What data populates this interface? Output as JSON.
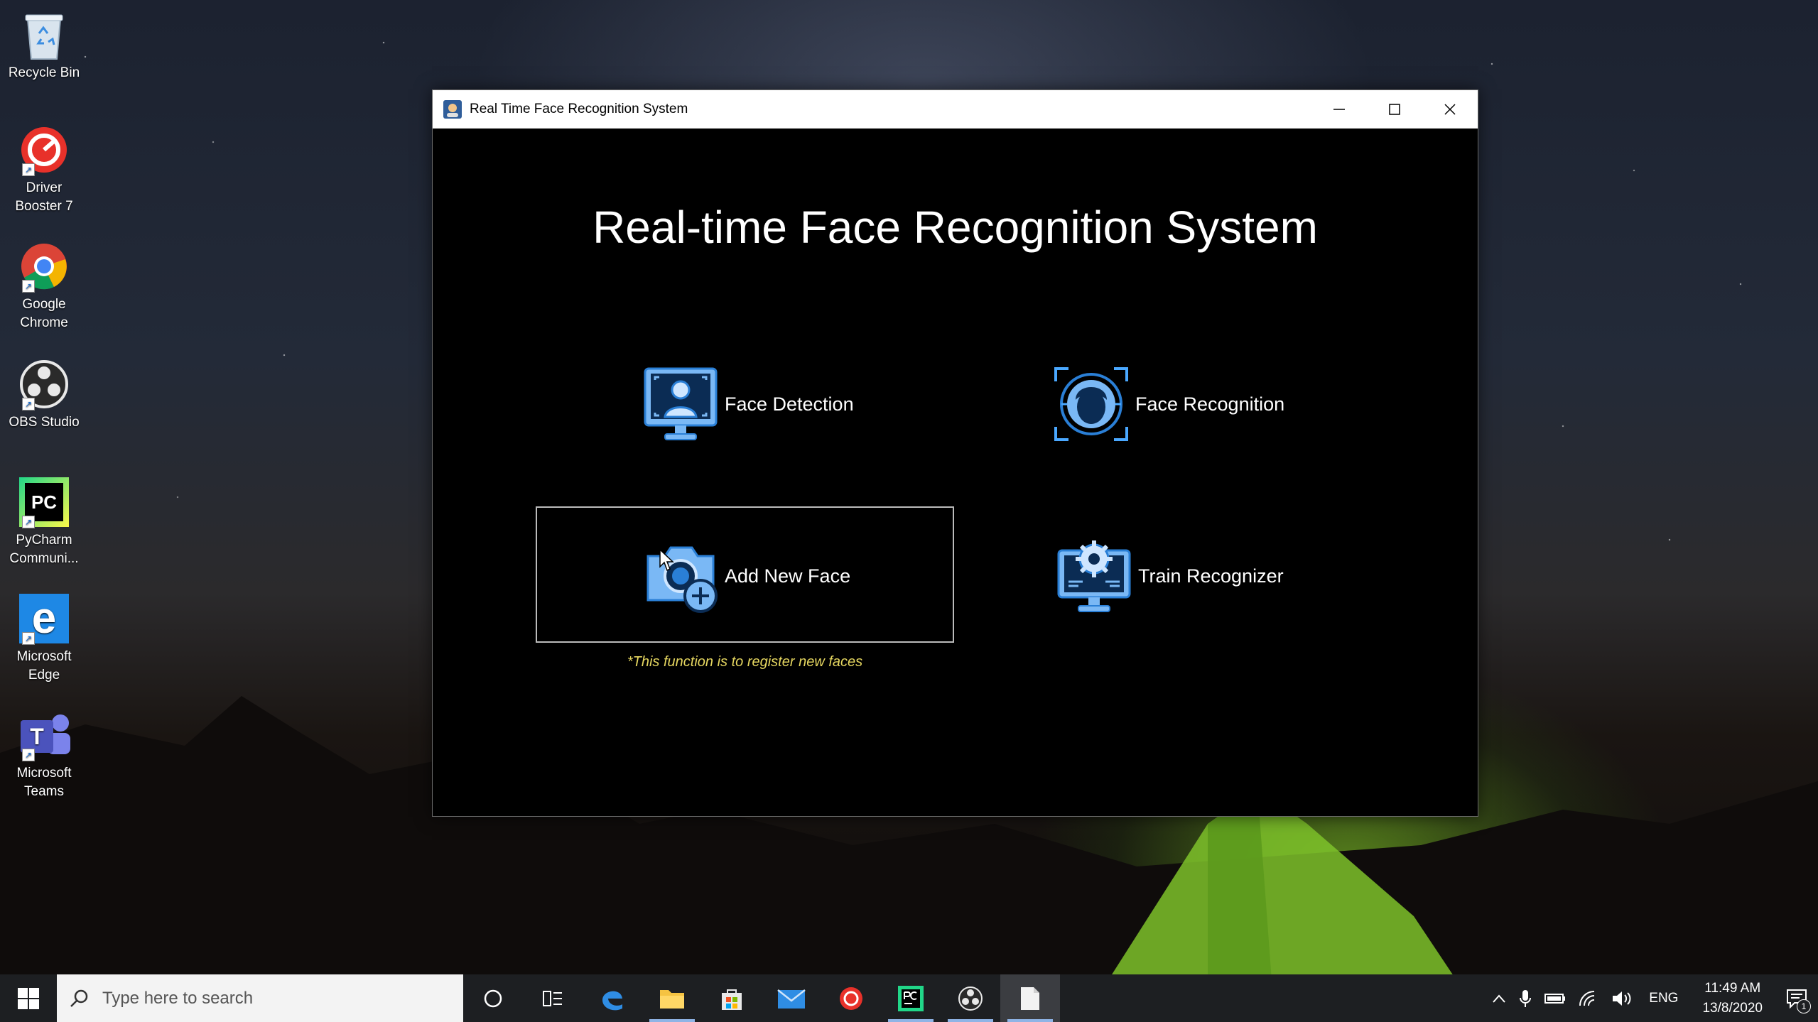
{
  "desktop": {
    "icons": [
      {
        "label": "Recycle Bin",
        "icon": "recycle-bin-icon"
      },
      {
        "label": "Driver Booster 7",
        "icon": "driver-booster-icon"
      },
      {
        "label": "Google Chrome",
        "icon": "chrome-icon"
      },
      {
        "label": "OBS Studio",
        "icon": "obs-icon"
      },
      {
        "label": "PyCharm Communi...",
        "icon": "pycharm-icon",
        "glyph": "PC"
      },
      {
        "label": "Microsoft Edge",
        "icon": "edge-icon",
        "glyph": "e"
      },
      {
        "label": "Microsoft Teams",
        "icon": "teams-icon",
        "glyph": "T"
      }
    ],
    "shortcut_arrow": "↗"
  },
  "window": {
    "title": "Real Time Face Recognition System",
    "heading": "Real-time Face Recognition System",
    "buttons": {
      "face_detection": "Face Detection",
      "face_recognition": "Face Recognition",
      "add_new_face": "Add New Face",
      "train_recognizer": "Train Recognizer"
    },
    "note": "*This function is to register new faces",
    "accent_color": "#4aa8ff",
    "note_color": "#e6d760"
  },
  "taskbar": {
    "search_placeholder": "Type here to search",
    "tray": {
      "language": "ENG",
      "time": "11:49 AM",
      "date": "13/8/2020",
      "notification_count": "1"
    }
  }
}
